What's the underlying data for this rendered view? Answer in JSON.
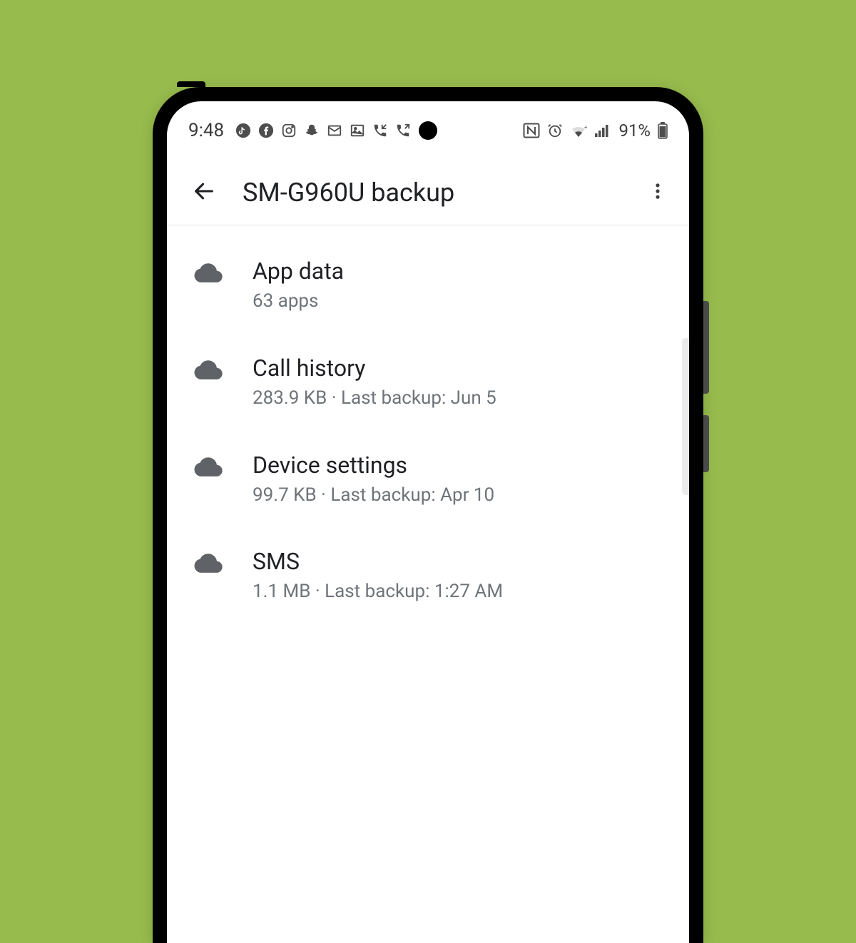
{
  "statusbar": {
    "time": "9:48",
    "battery_text": "91%"
  },
  "appbar": {
    "title": "SM-G960U backup"
  },
  "items": [
    {
      "title": "App data",
      "subtitle": "63 apps"
    },
    {
      "title": "Call history",
      "subtitle": "283.9 KB · Last backup: Jun 5"
    },
    {
      "title": "Device settings",
      "subtitle": "99.7 KB · Last backup: Apr 10"
    },
    {
      "title": "SMS",
      "subtitle": "1.1 MB · Last backup: 1:27 AM"
    }
  ]
}
